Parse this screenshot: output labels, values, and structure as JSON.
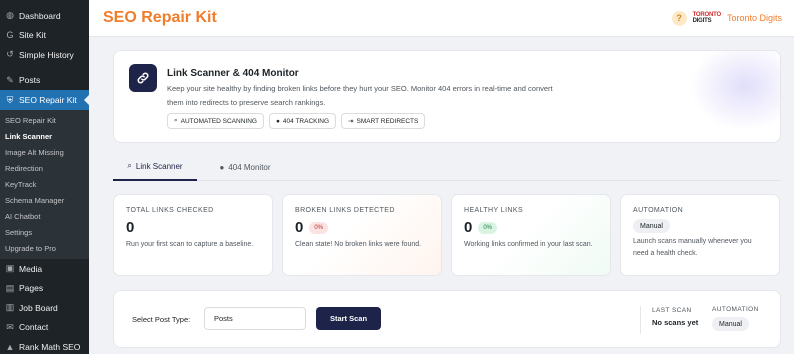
{
  "sidebar": {
    "items_top": [
      {
        "label": "Dashboard",
        "icon": "dashboard-icon",
        "glyph": "◍"
      },
      {
        "label": "Site Kit",
        "icon": "g-icon",
        "glyph": "G"
      },
      {
        "label": "Simple History",
        "icon": "history-icon",
        "glyph": "↺"
      }
    ],
    "posts": {
      "label": "Posts",
      "icon": "pin-icon",
      "glyph": "✎"
    },
    "active": {
      "label": "SEO Repair Kit",
      "icon": "shield-icon",
      "glyph": "⛨"
    },
    "submenu": [
      "SEO Repair Kit",
      "Link Scanner",
      "Image Alt Missing",
      "Redirection",
      "KeyTrack",
      "Schema Manager",
      "AI Chatbot",
      "Settings",
      "Upgrade to Pro"
    ],
    "current_sub_index": 1,
    "items_bottom": [
      {
        "label": "Media",
        "icon": "media-icon",
        "glyph": "▣"
      },
      {
        "label": "Pages",
        "icon": "pages-icon",
        "glyph": "▤"
      },
      {
        "label": "Job Board",
        "icon": "briefcase-icon",
        "glyph": "▥"
      },
      {
        "label": "Contact",
        "icon": "envelope-icon",
        "glyph": "✉"
      },
      {
        "label": "Rank Math SEO",
        "icon": "chart-icon",
        "glyph": "▲"
      }
    ]
  },
  "header": {
    "title": "SEO Repair Kit",
    "help": "?",
    "brand_mark_top": "TORONTO",
    "brand_mark_bottom": "DIGITS",
    "brand_name": "Toronto Digits"
  },
  "hero": {
    "title": "Link Scanner & 404 Monitor",
    "description": "Keep your site healthy by finding broken links before they hurt your SEO. Monitor 404 errors in real-time and convert them into redirects to preserve search rankings.",
    "tags": [
      "AUTOMATED SCANNING",
      "404 TRACKING",
      "SMART REDIRECTS"
    ]
  },
  "tabs": [
    "Link Scanner",
    "404 Monitor"
  ],
  "stats": {
    "total": {
      "label": "TOTAL LINKS CHECKED",
      "value": "0",
      "note": "Run your first scan to capture a baseline."
    },
    "broken": {
      "label": "BROKEN LINKS DETECTED",
      "value": "0",
      "pill": "0%",
      "note": "Clean state! No broken links were found."
    },
    "healthy": {
      "label": "HEALTHY LINKS",
      "value": "0",
      "pill": "0%",
      "note": "Working links confirmed in your last scan."
    },
    "automation": {
      "label": "AUTOMATION",
      "pill": "Manual",
      "note": "Launch scans manually whenever you need a health check."
    }
  },
  "scan": {
    "select_label": "Select Post Type:",
    "post_type": "Posts",
    "button": "Start Scan",
    "last_scan_label": "LAST SCAN",
    "last_scan_value": "No scans yet",
    "automation_label": "AUTOMATION",
    "automation_value": "Manual"
  },
  "colors": {
    "accent": "#f07d2c",
    "navy": "#1d2349",
    "wp_blue": "#2271b1",
    "sidebar_bg": "#1d2327"
  }
}
